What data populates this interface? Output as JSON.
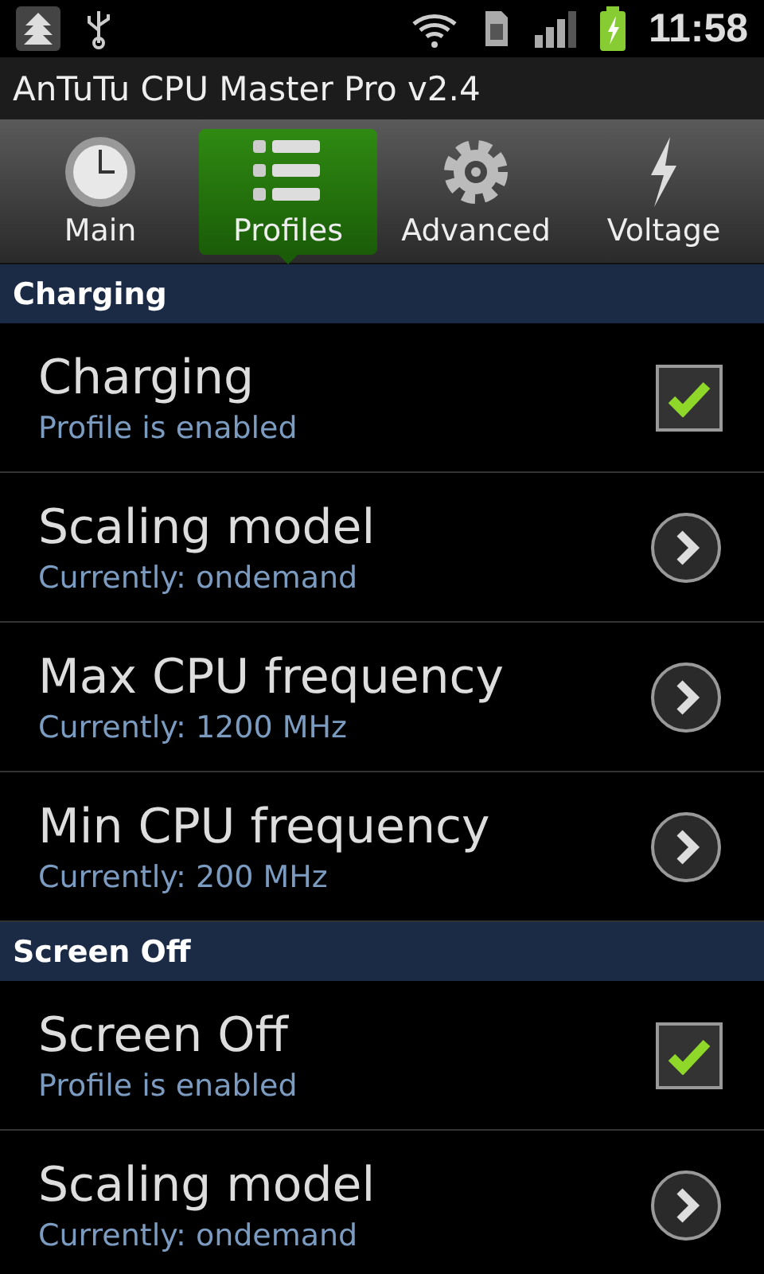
{
  "status_bar": {
    "time": "11:58"
  },
  "window": {
    "title": "AnTuTu CPU Master Pro v2.4"
  },
  "tabs": [
    {
      "label": "Main",
      "selected": false
    },
    {
      "label": "Profiles",
      "selected": true
    },
    {
      "label": "Advanced",
      "selected": false
    },
    {
      "label": "Voltage",
      "selected": false
    }
  ],
  "sections": [
    {
      "title": "Charging",
      "rows": [
        {
          "kind": "checkbox",
          "title": "Charging",
          "summary": "Profile is enabled",
          "checked": true
        },
        {
          "kind": "arrow",
          "title": "Scaling model",
          "summary": "Currently: ondemand"
        },
        {
          "kind": "arrow",
          "title": "Max CPU frequency",
          "summary": "Currently: 1200 MHz"
        },
        {
          "kind": "arrow",
          "title": "Min CPU frequency",
          "summary": "Currently: 200 MHz"
        }
      ]
    },
    {
      "title": "Screen Off",
      "rows": [
        {
          "kind": "checkbox",
          "title": "Screen Off",
          "summary": "Profile is enabled",
          "checked": true
        },
        {
          "kind": "arrow",
          "title": "Scaling model",
          "summary": "Currently: ondemand"
        }
      ]
    }
  ]
}
